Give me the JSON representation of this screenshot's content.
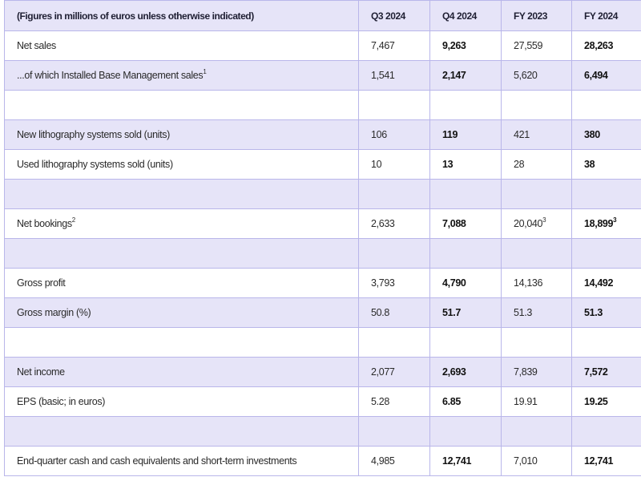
{
  "table": {
    "headers": [
      "(Figures in millions of euros unless otherwise indicated)",
      "Q3 2024",
      "Q4 2024",
      "FY 2023",
      "FY 2024"
    ],
    "rows": [
      {
        "label": "Net sales",
        "label_sup": "",
        "values": [
          "7,467",
          "9,263",
          "27,559",
          "28,263"
        ],
        "sups": [
          "",
          "",
          "",
          ""
        ]
      },
      {
        "label": "...of which Installed Base Management sales",
        "label_sup": "1",
        "values": [
          "1,541",
          "2,147",
          "5,620",
          "6,494"
        ],
        "sups": [
          "",
          "",
          "",
          ""
        ]
      },
      {
        "label": "",
        "label_sup": "",
        "values": [
          "",
          "",
          "",
          ""
        ],
        "sups": [
          "",
          "",
          "",
          ""
        ]
      },
      {
        "label": "New lithography systems sold (units)",
        "label_sup": "",
        "values": [
          "106",
          "119",
          "421",
          "380"
        ],
        "sups": [
          "",
          "",
          "",
          ""
        ]
      },
      {
        "label": "Used lithography systems sold (units)",
        "label_sup": "",
        "values": [
          "10",
          "13",
          "28",
          "38"
        ],
        "sups": [
          "",
          "",
          "",
          ""
        ]
      },
      {
        "label": "",
        "label_sup": "",
        "values": [
          "",
          "",
          "",
          ""
        ],
        "sups": [
          "",
          "",
          "",
          ""
        ]
      },
      {
        "label": "Net bookings",
        "label_sup": "2",
        "values": [
          "2,633",
          "7,088",
          "20,040",
          "18,899"
        ],
        "sups": [
          "",
          "",
          "3",
          "3"
        ]
      },
      {
        "label": "",
        "label_sup": "",
        "values": [
          "",
          "",
          "",
          ""
        ],
        "sups": [
          "",
          "",
          "",
          ""
        ]
      },
      {
        "label": "Gross profit",
        "label_sup": "",
        "values": [
          "3,793",
          "4,790",
          "14,136",
          "14,492"
        ],
        "sups": [
          "",
          "",
          "",
          ""
        ]
      },
      {
        "label": "Gross margin (%)",
        "label_sup": "",
        "values": [
          "50.8",
          "51.7",
          "51.3",
          "51.3"
        ],
        "sups": [
          "",
          "",
          "",
          ""
        ]
      },
      {
        "label": "",
        "label_sup": "",
        "values": [
          "",
          "",
          "",
          ""
        ],
        "sups": [
          "",
          "",
          "",
          ""
        ]
      },
      {
        "label": "Net income",
        "label_sup": "",
        "values": [
          "2,077",
          "2,693",
          "7,839",
          "7,572"
        ],
        "sups": [
          "",
          "",
          "",
          ""
        ]
      },
      {
        "label": "EPS (basic; in euros)",
        "label_sup": "",
        "values": [
          "5.28",
          "6.85",
          "19.91",
          "19.25"
        ],
        "sups": [
          "",
          "",
          "",
          ""
        ]
      },
      {
        "label": "",
        "label_sup": "",
        "values": [
          "",
          "",
          "",
          ""
        ],
        "sups": [
          "",
          "",
          "",
          ""
        ]
      },
      {
        "label": "End-quarter cash and cash equivalents and short-term investments",
        "label_sup": "",
        "values": [
          "4,985",
          "12,741",
          "7,010",
          "12,741"
        ],
        "sups": [
          "",
          "",
          "",
          ""
        ]
      }
    ]
  },
  "colors": {
    "header_bg": "#e6e4f8",
    "alt_row_bg": "#e6e4f8",
    "border": "#b9b6ea"
  }
}
